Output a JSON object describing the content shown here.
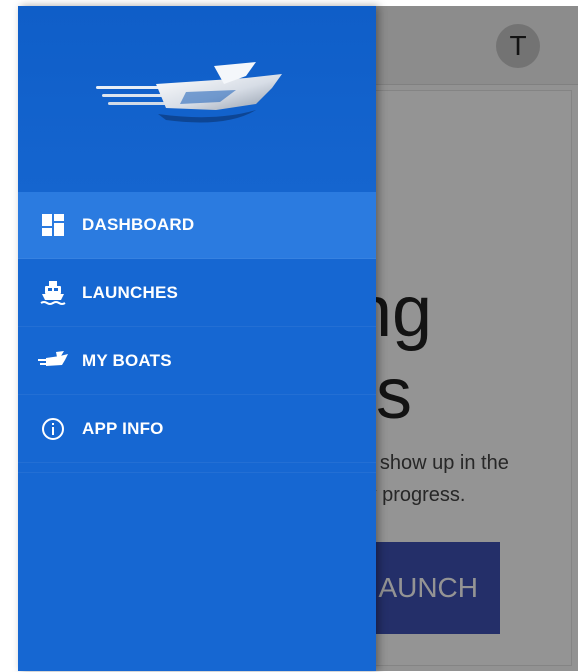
{
  "app": {
    "avatar_letter": "T",
    "heading_line1": "ing",
    "heading_line2": "es",
    "message_line1": "ill show up in the",
    "message_line2": "ıy progress.",
    "launch_button": "AUNCH"
  },
  "drawer": {
    "logo_icon": "boat-logo-icon",
    "items": [
      {
        "label": "DASHBOARD",
        "icon": "dashboard-icon",
        "active": true
      },
      {
        "label": "LAUNCHES",
        "icon": "ferry-icon",
        "active": false
      },
      {
        "label": "MY BOATS",
        "icon": "speedboat-icon",
        "active": false
      },
      {
        "label": "APP INFO",
        "icon": "info-icon",
        "active": false
      }
    ]
  },
  "colors": {
    "drawer_bg": "#1667d2",
    "active_item_bg": "#2b7be0",
    "launch_button_bg": "#3f51b5"
  }
}
